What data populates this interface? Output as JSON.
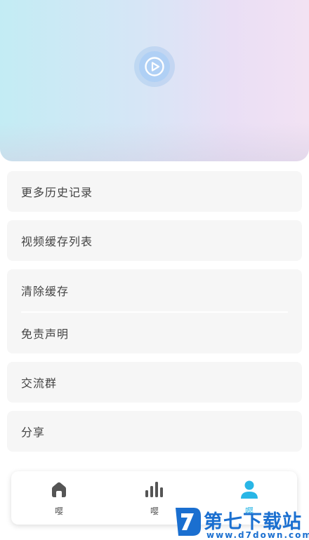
{
  "header": {
    "play_icon": "play-circle-icon"
  },
  "menu": {
    "history": "更多历史记录",
    "cache_list": "视频缓存列表",
    "clear_cache": "清除缓存",
    "disclaimer": "免责声明",
    "group": "交流群",
    "share": "分享"
  },
  "nav": {
    "items": [
      {
        "label": "嘤",
        "icon": "home-icon"
      },
      {
        "label": "嘤",
        "icon": "bar-chart-icon"
      },
      {
        "label": "嘤",
        "icon": "user-icon"
      }
    ],
    "active_color": "#29b6e6",
    "inactive_color": "#555555"
  },
  "watermark": {
    "text": "第七下载站",
    "url": "www.d7down.com"
  }
}
